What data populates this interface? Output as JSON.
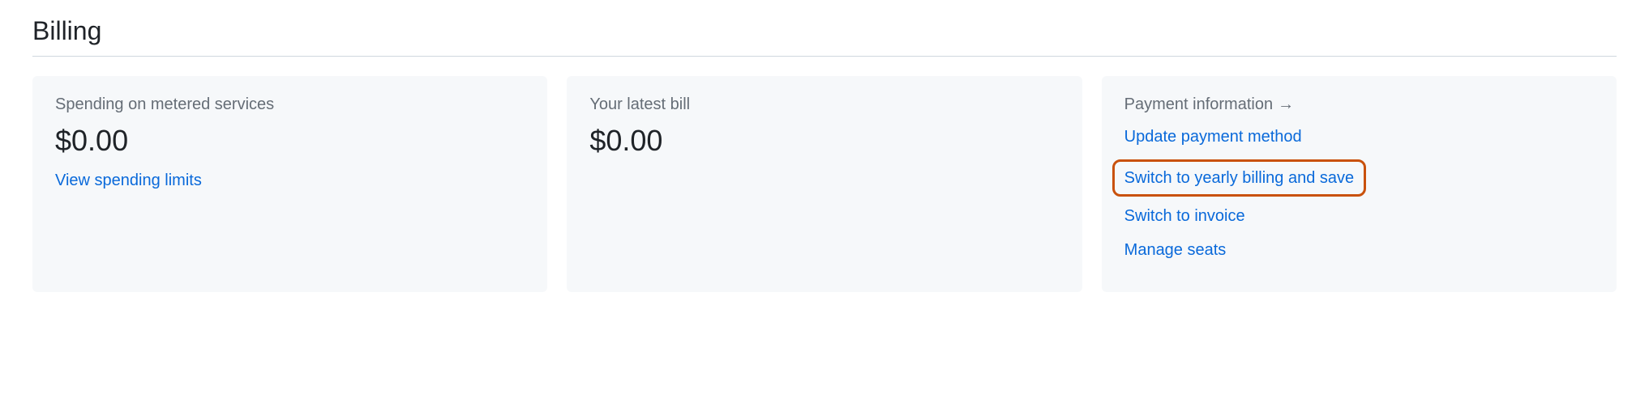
{
  "pageTitle": "Billing",
  "card1": {
    "title": "Spending on metered services",
    "amount": "$0.00",
    "link": "View spending limits"
  },
  "card2": {
    "title": "Your latest bill",
    "amount": "$0.00"
  },
  "card3": {
    "title": "Payment information",
    "arrow": "→",
    "links": {
      "updatePayment": "Update payment method",
      "switchYearly": "Switch to yearly billing and save",
      "switchInvoice": "Switch to invoice",
      "manageSeats": "Manage seats"
    }
  }
}
